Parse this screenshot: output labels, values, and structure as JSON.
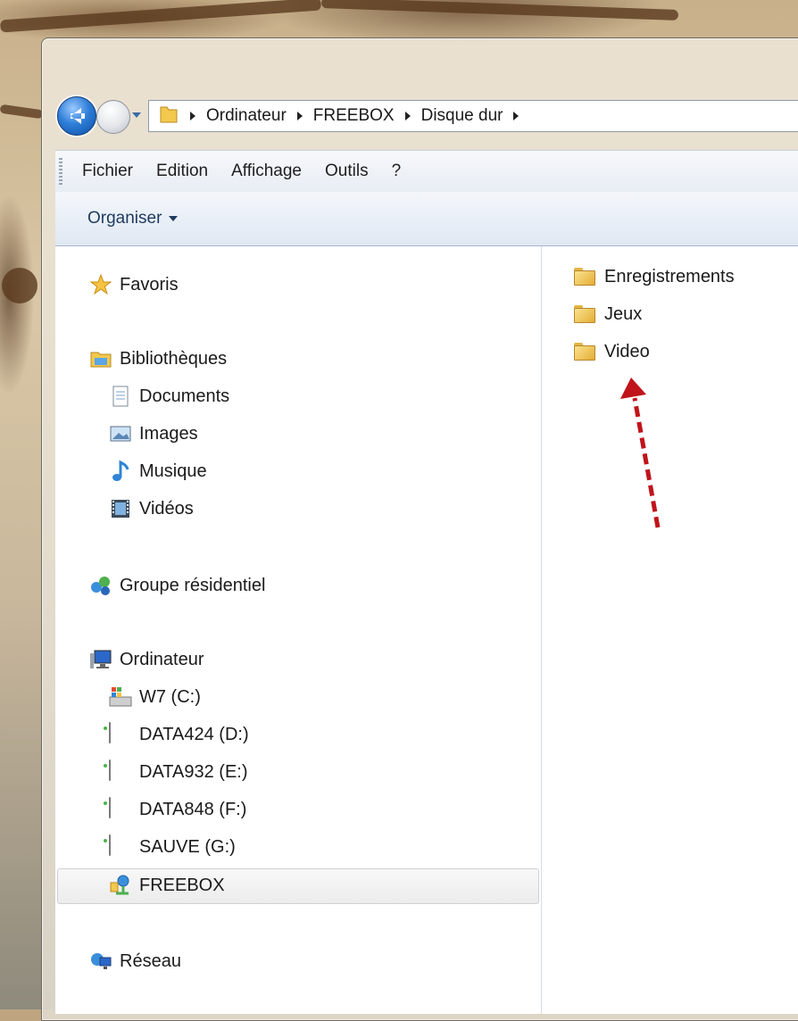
{
  "window": {
    "breadcrumb": [
      "Ordinateur",
      "FREEBOX",
      "Disque dur"
    ]
  },
  "menu": {
    "items": [
      "Fichier",
      "Edition",
      "Affichage",
      "Outils",
      "?"
    ]
  },
  "command_bar": {
    "organise_label": "Organiser"
  },
  "nav_pane": {
    "favorites": {
      "label": "Favoris",
      "icon": "star-icon"
    },
    "libraries": {
      "label": "Bibliothèques",
      "icon": "libraries-icon",
      "items": [
        {
          "label": "Documents",
          "icon": "documents-icon"
        },
        {
          "label": "Images",
          "icon": "images-icon"
        },
        {
          "label": "Musique",
          "icon": "music-icon"
        },
        {
          "label": "Vidéos",
          "icon": "videos-icon"
        }
      ]
    },
    "homegroup": {
      "label": "Groupe résidentiel",
      "icon": "homegroup-icon"
    },
    "computer": {
      "label": "Ordinateur",
      "icon": "computer-icon",
      "items": [
        {
          "label": "W7 (C:)",
          "icon": "system-drive-icon"
        },
        {
          "label": "DATA424 (D:)",
          "icon": "drive-icon"
        },
        {
          "label": "DATA932 (E:)",
          "icon": "drive-icon"
        },
        {
          "label": "DATA848 (F:)",
          "icon": "drive-icon"
        },
        {
          "label": "SAUVE (G:)",
          "icon": "drive-icon"
        },
        {
          "label": "FREEBOX",
          "icon": "network-device-icon",
          "selected": true
        }
      ]
    },
    "network": {
      "label": "Réseau",
      "icon": "network-icon"
    }
  },
  "content": {
    "folders": [
      "Enregistrements",
      "Jeux",
      "Video"
    ]
  },
  "colors": {
    "annotation_arrow": "#c0141b",
    "selection_bg": "#ececec"
  }
}
